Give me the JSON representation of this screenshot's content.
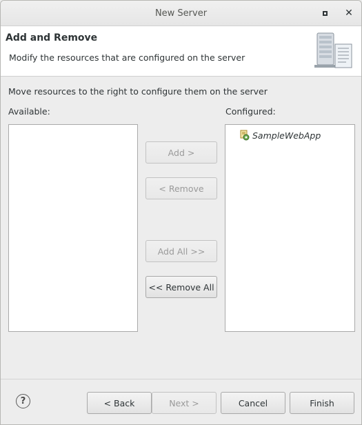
{
  "window": {
    "title": "New Server"
  },
  "banner": {
    "title": "Add and Remove",
    "description": "Modify the resources that are configured on the server"
  },
  "instruction": "Move resources to the right to configure them on the server",
  "available": {
    "label": "Available:",
    "items": []
  },
  "configured": {
    "label": "Configured:",
    "items": [
      {
        "label": "SampleWebApp",
        "icon": "web-module-icon"
      }
    ]
  },
  "buttons": {
    "add": "Add >",
    "remove": "< Remove",
    "add_all": "Add All >>",
    "remove_all": "<< Remove All"
  },
  "footer": {
    "help": "?",
    "back": "< Back",
    "next": "Next >",
    "cancel": "Cancel",
    "finish": "Finish"
  },
  "icons": {
    "maximize": "maximize-icon",
    "close": "close-icon",
    "banner": "server-wizard-icon",
    "help": "help-icon"
  },
  "colors": {
    "background": "#ededed",
    "banner_background": "#ffffff",
    "disabled_text": "#9a9a9a",
    "text": "#2e3436"
  }
}
